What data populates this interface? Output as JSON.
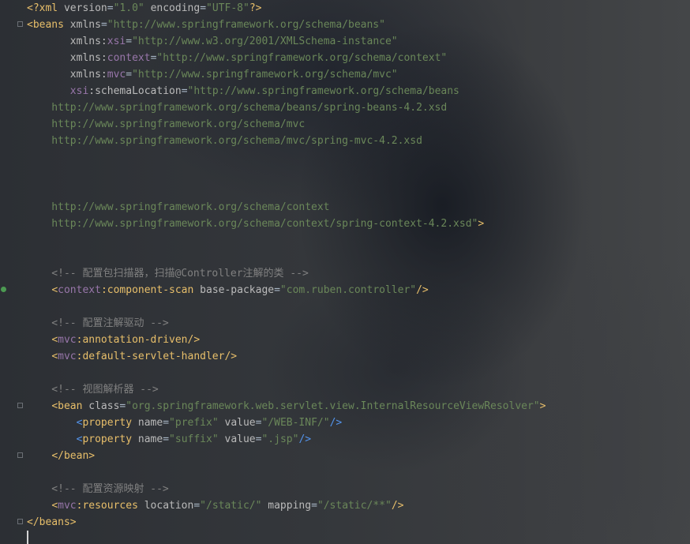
{
  "editor": {
    "language": "xml",
    "lines": [
      [
        {
          "c": "p",
          "t": "<?xml "
        },
        {
          "c": "n",
          "t": "version"
        },
        {
          "c": "t",
          "t": "="
        },
        {
          "c": "v",
          "t": "\"1.0\""
        },
        {
          "c": "t",
          "t": " "
        },
        {
          "c": "n",
          "t": "encoding"
        },
        {
          "c": "t",
          "t": "="
        },
        {
          "c": "v",
          "t": "\"UTF-8\""
        },
        {
          "c": "p",
          "t": "?>"
        }
      ],
      [
        {
          "c": "p",
          "t": "<beans "
        },
        {
          "c": "n",
          "t": "xmlns"
        },
        {
          "c": "t",
          "t": "="
        },
        {
          "c": "v",
          "t": "\"http://www.springframework.org/schema/beans\""
        }
      ],
      [
        {
          "c": "t",
          "t": "       "
        },
        {
          "c": "n",
          "t": "xmlns:"
        },
        {
          "c": "ns",
          "t": "xsi"
        },
        {
          "c": "t",
          "t": "="
        },
        {
          "c": "v",
          "t": "\"http://www.w3.org/2001/XMLSchema-instance\""
        }
      ],
      [
        {
          "c": "t",
          "t": "       "
        },
        {
          "c": "n",
          "t": "xmlns:"
        },
        {
          "c": "ns",
          "t": "context"
        },
        {
          "c": "t",
          "t": "="
        },
        {
          "c": "v",
          "t": "\"http://www.springframework.org/schema/context\""
        }
      ],
      [
        {
          "c": "t",
          "t": "       "
        },
        {
          "c": "n",
          "t": "xmlns:"
        },
        {
          "c": "ns",
          "t": "mvc"
        },
        {
          "c": "t",
          "t": "="
        },
        {
          "c": "v",
          "t": "\"http://www.springframework.org/schema/mvc\""
        }
      ],
      [
        {
          "c": "t",
          "t": "       "
        },
        {
          "c": "ns",
          "t": "xsi"
        },
        {
          "c": "n",
          "t": ":schemaLocation"
        },
        {
          "c": "t",
          "t": "="
        },
        {
          "c": "v",
          "t": "\"http://www.springframework.org/schema/beans"
        }
      ],
      [
        {
          "c": "v",
          "t": "    http://www.springframework.org/schema/beans/spring-beans-4.2.xsd"
        }
      ],
      [
        {
          "c": "v",
          "t": "    http://www.springframework.org/schema/mvc"
        }
      ],
      [
        {
          "c": "v",
          "t": "    http://www.springframework.org/schema/mvc/spring-mvc-4.2.xsd"
        }
      ],
      [],
      [],
      [],
      [
        {
          "c": "v",
          "t": "    http://www.springframework.org/schema/context"
        }
      ],
      [
        {
          "c": "v",
          "t": "    http://www.springframework.org/schema/context/spring-context-4.2.xsd\""
        },
        {
          "c": "p",
          "t": ">"
        }
      ],
      [],
      [],
      [
        {
          "c": "c",
          "t": "    <!-- 配置包扫描器，扫描@Controller注解的类 -->"
        }
      ],
      [
        {
          "c": "t",
          "t": "    "
        },
        {
          "c": "p",
          "t": "<"
        },
        {
          "c": "ns",
          "t": "context"
        },
        {
          "c": "p",
          "t": ":component-scan "
        },
        {
          "c": "n",
          "t": "base-package"
        },
        {
          "c": "t",
          "t": "="
        },
        {
          "c": "v",
          "t": "\"com.ruben.controller\""
        },
        {
          "c": "p",
          "t": "/>"
        }
      ],
      [],
      [
        {
          "c": "c",
          "t": "    <!-- 配置注解驱动 -->"
        }
      ],
      [
        {
          "c": "t",
          "t": "    "
        },
        {
          "c": "p",
          "t": "<"
        },
        {
          "c": "ns",
          "t": "mvc"
        },
        {
          "c": "p",
          "t": ":annotation-driven/>"
        }
      ],
      [
        {
          "c": "t",
          "t": "    "
        },
        {
          "c": "p",
          "t": "<"
        },
        {
          "c": "ns",
          "t": "mvc"
        },
        {
          "c": "p",
          "t": ":default-servlet-handler/>"
        }
      ],
      [],
      [
        {
          "c": "c",
          "t": "    <!-- 视图解析器 -->"
        }
      ],
      [
        {
          "c": "t",
          "t": "    "
        },
        {
          "c": "p",
          "t": "<bean "
        },
        {
          "c": "n",
          "t": "class"
        },
        {
          "c": "t",
          "t": "="
        },
        {
          "c": "v",
          "t": "\"org.springframework.web.servlet.view.InternalResourceViewResolver\""
        },
        {
          "c": "p",
          "t": ">"
        }
      ],
      [
        {
          "c": "t",
          "t": "        "
        },
        {
          "c": "b",
          "t": "<"
        },
        {
          "c": "p",
          "t": "property "
        },
        {
          "c": "n",
          "t": "name"
        },
        {
          "c": "t",
          "t": "="
        },
        {
          "c": "v",
          "t": "\"prefix\""
        },
        {
          "c": "t",
          "t": " "
        },
        {
          "c": "n",
          "t": "value"
        },
        {
          "c": "t",
          "t": "="
        },
        {
          "c": "v",
          "t": "\"/WEB-INF/\""
        },
        {
          "c": "b",
          "t": "/>"
        }
      ],
      [
        {
          "c": "t",
          "t": "        "
        },
        {
          "c": "b",
          "t": "<"
        },
        {
          "c": "p",
          "t": "property "
        },
        {
          "c": "n",
          "t": "name"
        },
        {
          "c": "t",
          "t": "="
        },
        {
          "c": "v",
          "t": "\"suffix\""
        },
        {
          "c": "t",
          "t": " "
        },
        {
          "c": "n",
          "t": "value"
        },
        {
          "c": "t",
          "t": "="
        },
        {
          "c": "v",
          "t": "\".jsp\""
        },
        {
          "c": "b",
          "t": "/>"
        }
      ],
      [
        {
          "c": "t",
          "t": "    "
        },
        {
          "c": "p",
          "t": "</bean>"
        }
      ],
      [],
      [
        {
          "c": "c",
          "t": "    <!-- 配置资源映射 -->"
        }
      ],
      [
        {
          "c": "t",
          "t": "    "
        },
        {
          "c": "p",
          "t": "<"
        },
        {
          "c": "ns",
          "t": "mvc"
        },
        {
          "c": "p",
          "t": ":resources "
        },
        {
          "c": "n",
          "t": "location"
        },
        {
          "c": "t",
          "t": "="
        },
        {
          "c": "v",
          "t": "\"/static/\""
        },
        {
          "c": "t",
          "t": " "
        },
        {
          "c": "n",
          "t": "mapping"
        },
        {
          "c": "t",
          "t": "="
        },
        {
          "c": "v",
          "t": "\"/static/**\""
        },
        {
          "c": "p",
          "t": "/>"
        }
      ],
      [
        {
          "c": "p",
          "t": "</beans>"
        }
      ],
      []
    ]
  }
}
